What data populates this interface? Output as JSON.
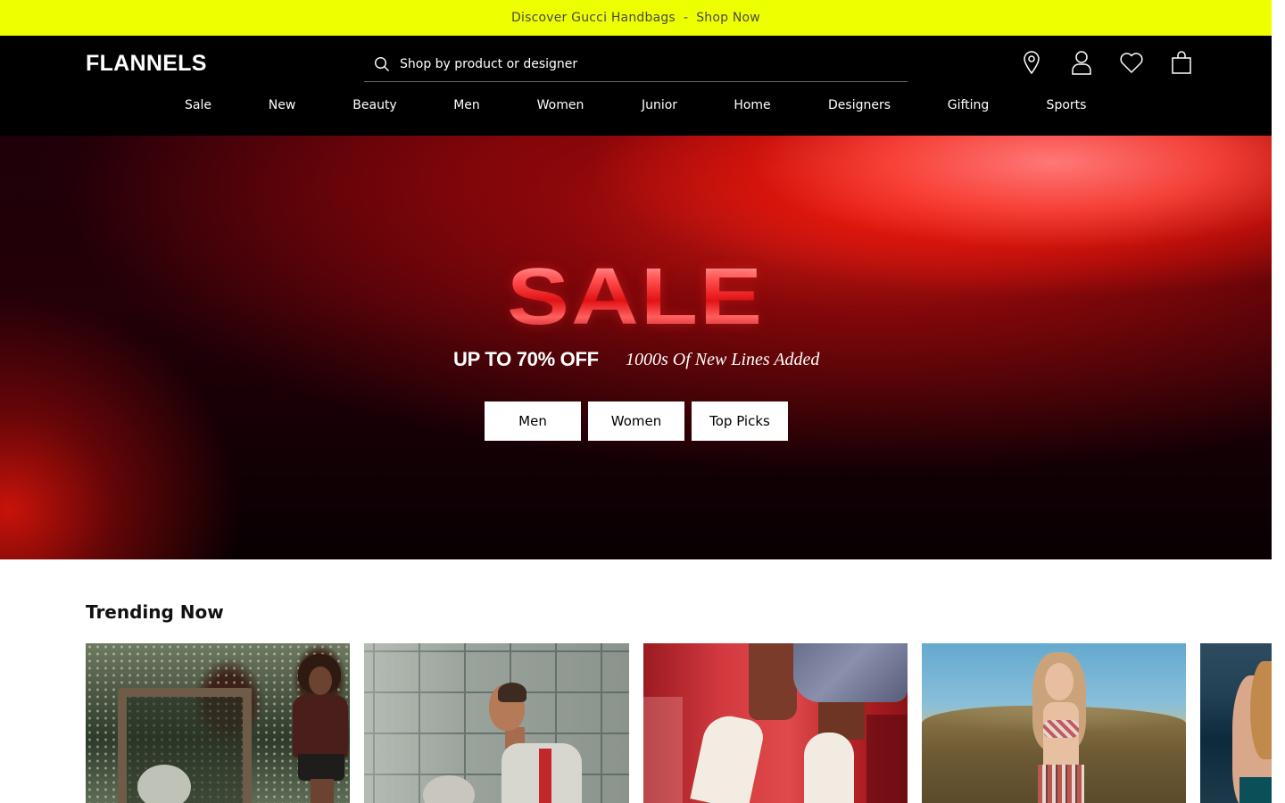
{
  "promo": {
    "text": "Discover Gucci Handbags",
    "separator": "-",
    "link": "Shop Now",
    "background": "#eeff00"
  },
  "header": {
    "logo": "FLANNELS",
    "search_placeholder": "Shop by product or designer",
    "icons": [
      "location-pin-icon",
      "account-icon",
      "wishlist-heart-icon",
      "shopping-bag-icon"
    ]
  },
  "nav": {
    "items": [
      "Sale",
      "New",
      "Beauty",
      "Men",
      "Women",
      "Junior",
      "Home",
      "Designers",
      "Gifting",
      "Sports"
    ]
  },
  "hero": {
    "headline": "SALE",
    "discount": "UP TO 70% OFF",
    "subline": "1000s Of New Lines Added",
    "buttons": [
      "Men",
      "Women",
      "Top Picks"
    ]
  },
  "trending": {
    "title": "Trending Now"
  }
}
